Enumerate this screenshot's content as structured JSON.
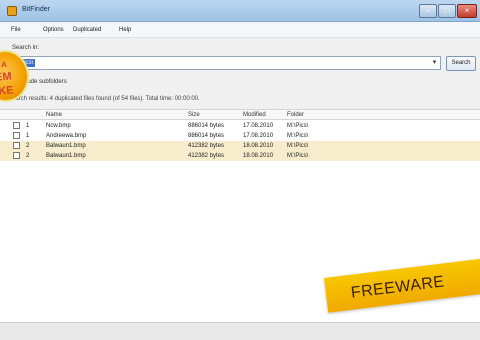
{
  "window": {
    "title": "BitFinder"
  },
  "menu": [
    {
      "label": "File"
    },
    {
      "label": "Options"
    },
    {
      "label": "Duplicated"
    },
    {
      "label": "Help"
    }
  ],
  "search": {
    "label": "Search in:",
    "path": "M:\\Pics\\",
    "button": "Search",
    "subfolders_label": "Include subfolders"
  },
  "results": {
    "text": "Search results: 4 duplicated files found (of 54 files). Total time: 00:00:00."
  },
  "table": {
    "headers": [
      "Name",
      "Size",
      "Modified",
      "Folder"
    ],
    "rows": [
      {
        "group": "1",
        "name": "Ncw.bmp",
        "size": "886014 bytes",
        "modified": "17.08.2010",
        "folder": "M:\\Pics\\"
      },
      {
        "group": "1",
        "name": "Andreewa.bmp",
        "size": "886014 bytes",
        "modified": "17.08.2010",
        "folder": "M:\\Pics\\"
      },
      {
        "group": "2",
        "name": "Balwaun1.bmp",
        "size": "412382 bytes",
        "modified": "18.08.2010",
        "folder": "M:\\Pics\\"
      },
      {
        "group": "2",
        "name": "Balwaun1.bmp",
        "size": "412382 bytes",
        "modified": "18.08.2010",
        "folder": "M:\\Pics\\"
      }
    ]
  },
  "overlays": {
    "sticker_lines": [
      "A",
      "EM",
      "KE"
    ],
    "banner": "FREEWARE"
  },
  "colors": {
    "titlebar": "#a9c9ea",
    "selection": "#3f6fc6",
    "highlight": "#f7edcc",
    "banner": "#f5b800"
  }
}
